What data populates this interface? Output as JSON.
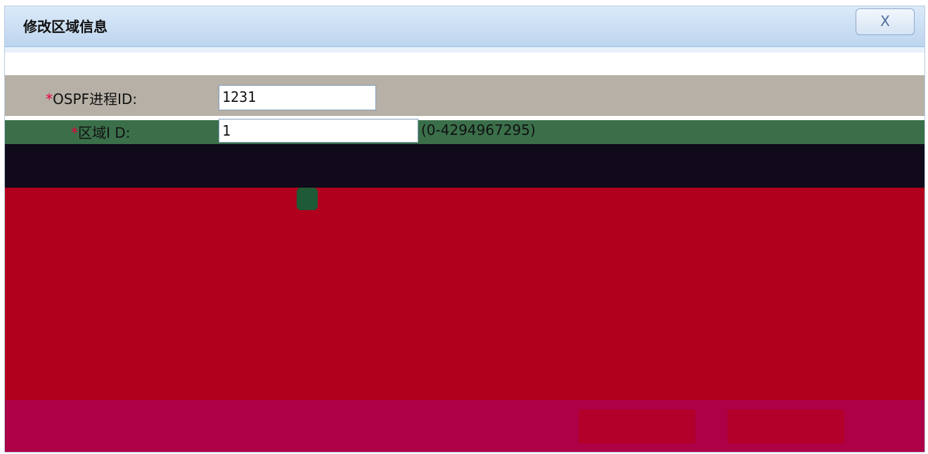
{
  "dialog": {
    "title": "修改区域信息",
    "close_label": "X"
  },
  "form": {
    "required_mark": "*",
    "ospf_label": "OSPF进程ID:",
    "ospf_value": "1231",
    "area_label": "区域I D:",
    "area_value": "1",
    "area_hint": "(0-4294967295)"
  },
  "colors": {
    "titlebar": "#bdd5ef",
    "gray_band": "#b6b0a6",
    "green_band": "#3a6f4a",
    "dark_band": "#100a1a",
    "red_band": "#b0001e",
    "required": "#e8003a"
  }
}
